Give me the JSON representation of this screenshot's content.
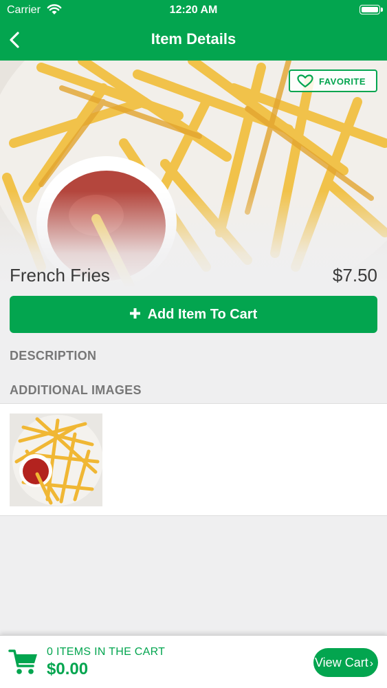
{
  "status_bar": {
    "carrier": "Carrier",
    "time": "12:20 AM"
  },
  "nav": {
    "title": "Item Details"
  },
  "item": {
    "name": "French Fries",
    "price": "$7.50",
    "favorite_label": "FAVORITE",
    "add_to_cart_label": "Add Item To Cart",
    "add_icon": "plus-icon"
  },
  "sections": {
    "description": "DESCRIPTION",
    "additional_images": "ADDITIONAL IMAGES"
  },
  "cart": {
    "count_label": "0 ITEMS IN THE CART",
    "total": "$0.00",
    "view_cart_label": "View Cart",
    "icon": "cart-icon"
  },
  "colors": {
    "accent": "#03a54f",
    "background": "#efeff0"
  }
}
